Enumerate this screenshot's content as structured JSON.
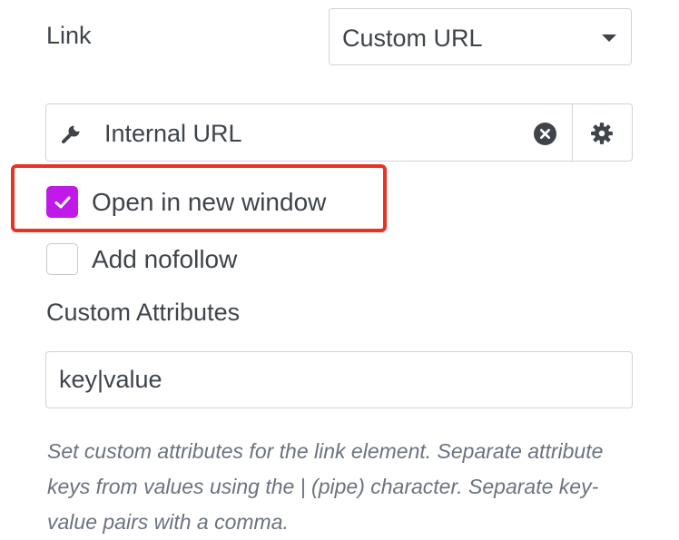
{
  "link": {
    "label": "Link",
    "select_value": "Custom URL"
  },
  "url_field": {
    "value": "Internal URL",
    "icons": [
      "wrench-icon",
      "clear-icon",
      "gear-icon"
    ]
  },
  "options": {
    "open_new_window": {
      "label": "Open in new window",
      "checked": true
    },
    "nofollow": {
      "label": "Add nofollow",
      "checked": false
    }
  },
  "custom_attributes": {
    "label": "Custom Attributes",
    "value": "key|value",
    "help": "Set custom attributes for the link element. Separate attribute keys from values using the | (pipe) character. Separate key-value pairs with a comma."
  },
  "colors": {
    "accent": "#c01ae8",
    "highlight": "#e83224",
    "border": "#cfd3d8",
    "text": "#3f444b"
  }
}
